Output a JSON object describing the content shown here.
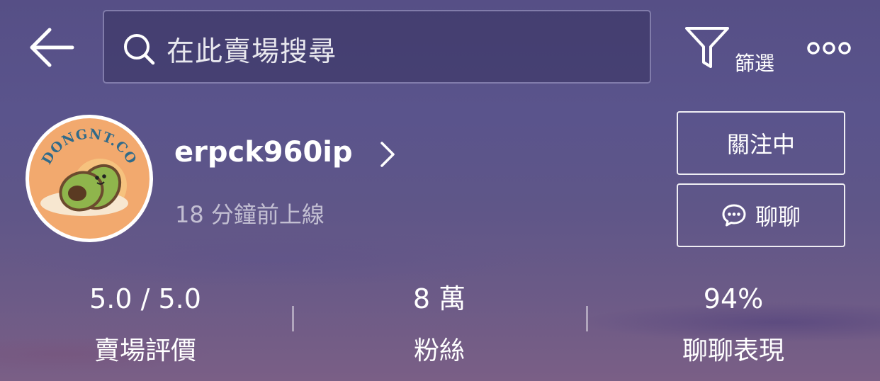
{
  "header": {
    "back_icon": "arrow-left-icon",
    "search": {
      "placeholder": "在此賣場搜尋",
      "icon": "search-icon"
    },
    "filter": {
      "label": "篩選",
      "icon": "filter-icon"
    },
    "more_icon": "more-dots-icon"
  },
  "shop": {
    "avatar": {
      "logo_text": "DONGNT.CO"
    },
    "username": "erpck960ip",
    "online_status": "18 分鐘前上線",
    "buttons": {
      "follow_label": "關注中",
      "chat_label": "聊聊",
      "chat_icon": "chat-bubble-icon"
    }
  },
  "stats": [
    {
      "value": "5.0 / 5.0",
      "label": "賣場評價"
    },
    {
      "value": "8 萬",
      "label": "粉絲"
    },
    {
      "value": "94%",
      "label": "聊聊表現"
    }
  ],
  "colors": {
    "accent_text": "#ffffff",
    "avatar_bg": "#f2a96e",
    "avocado_green": "#7fa84a"
  }
}
